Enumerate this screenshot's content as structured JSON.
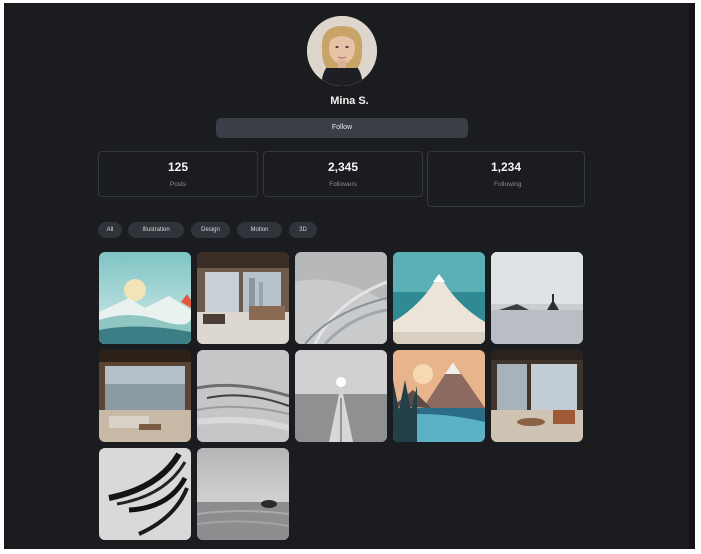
{
  "profile": {
    "name": "Mina S.",
    "follow_label": "Follow"
  },
  "stats": [
    {
      "value": "125",
      "label": "Posts"
    },
    {
      "value": "2,345",
      "label": "Followers"
    },
    {
      "value": "1,234",
      "label": "Following"
    }
  ],
  "filters": [
    "All",
    "Illustration",
    "Design",
    "Motion",
    "3D"
  ],
  "gallery": {
    "items": [
      "sunset-mountain-illustration",
      "modern-interior-photo",
      "abstract-gray-waves",
      "snowy-peak-illustration",
      "island-lake-photo",
      "living-room-interior-photo",
      "abstract-brush-strokes",
      "sunset-road-landscape",
      "mountain-lake-illustration",
      "living-room-interior-photo-2",
      "abstract-black-strokes",
      "stone-on-sand-landscape"
    ]
  },
  "colors": {
    "background": "#1b1c1f",
    "button": "#3a3f47",
    "chip": "#30343a",
    "card_border": "#34373c"
  }
}
